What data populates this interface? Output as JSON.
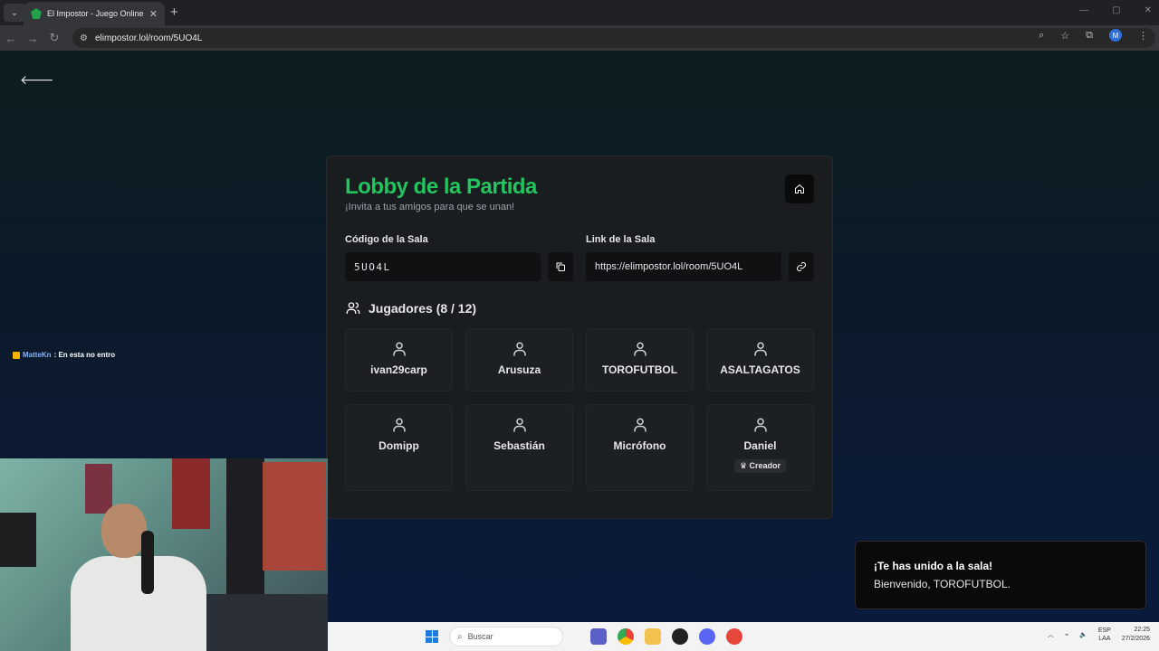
{
  "browser": {
    "tab_title": "El Impostor - Juego Online Gra",
    "url": "elimpostor.lol/room/5UO4L"
  },
  "chat": {
    "user": "MatteKn",
    "message": ": En esta no entro"
  },
  "lobby": {
    "title": "Lobby de la Partida",
    "subtitle": "¡Invita a tus amigos para que se unan!",
    "code_label": "Código de la Sala",
    "code_value": "5UO4L",
    "link_label": "Link de la Sala",
    "link_value": "https://elimpostor.lol/room/5UO4L",
    "players_header": "Jugadores (8 / 12)",
    "players": [
      {
        "name": "ivan29carp"
      },
      {
        "name": "Arusuza"
      },
      {
        "name": "TOROFUTBOL"
      },
      {
        "name": "ASALTAGATOS"
      },
      {
        "name": "Domipp"
      },
      {
        "name": "Sebastián"
      },
      {
        "name": "Micrófono"
      },
      {
        "name": "Daniel",
        "badge": "♛ Creador"
      }
    ]
  },
  "toast": {
    "title": "¡Te has unido a la sala!",
    "message": "Bienvenido, TOROFUTBOL."
  },
  "taskbar": {
    "search_placeholder": "Buscar",
    "lang_top": "ESP",
    "lang_bottom": "LAA",
    "time": "22:25",
    "date": "27/2/2026"
  }
}
